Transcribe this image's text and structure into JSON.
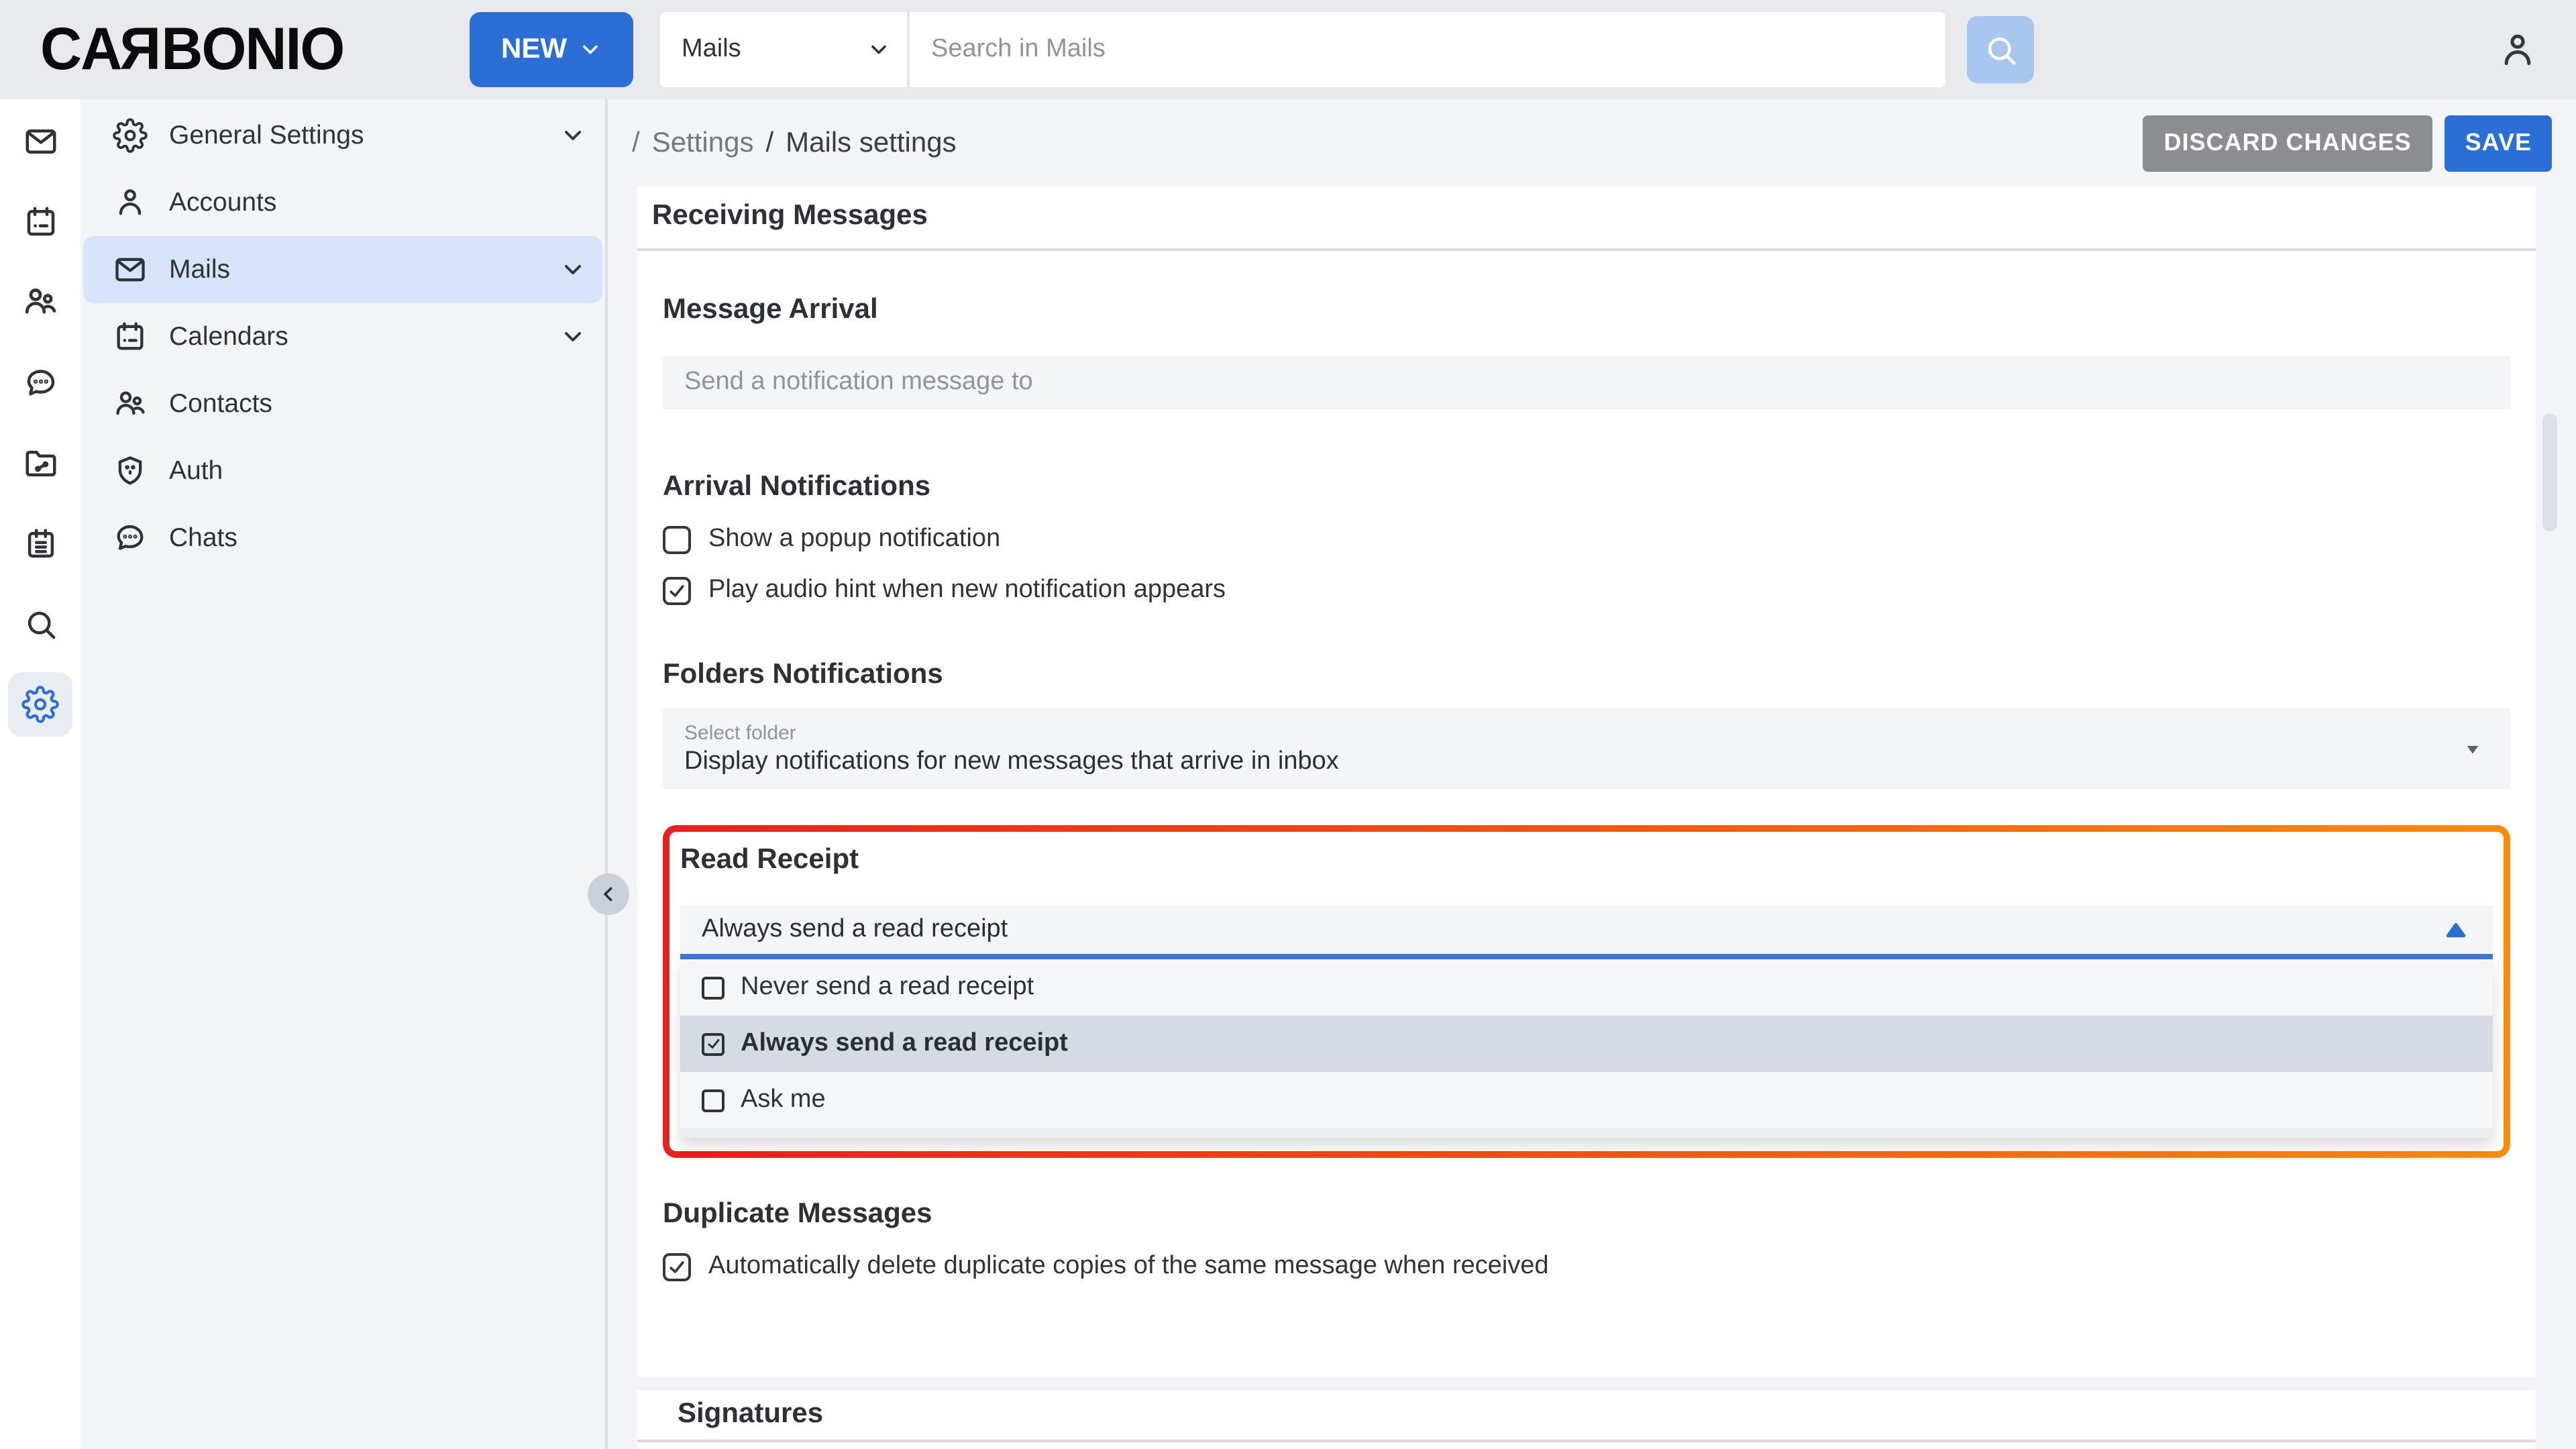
{
  "topbar": {
    "logo_part1": "CA",
    "logo_r": "R",
    "logo_part2": "BONIO",
    "new_button": "NEW",
    "search_scope": "Mails",
    "search_placeholder": "Search in Mails",
    "icons": [
      "chevron-down-icon",
      "search-icon",
      "person-icon"
    ]
  },
  "rail": {
    "items": [
      {
        "icon": "mail-icon",
        "active": false
      },
      {
        "icon": "calendar-icon",
        "active": false
      },
      {
        "icon": "contacts-icon",
        "active": false
      },
      {
        "icon": "chat-icon",
        "active": false
      },
      {
        "icon": "files-icon",
        "active": false
      },
      {
        "icon": "tasks-icon",
        "active": false
      },
      {
        "icon": "search-icon",
        "active": false
      },
      {
        "icon": "settings-gear-icon",
        "active": true
      }
    ]
  },
  "sidebar": {
    "items": [
      {
        "label": "General Settings",
        "icon": "gear-icon",
        "expandable": true,
        "selected": false
      },
      {
        "label": "Accounts",
        "icon": "person-icon",
        "expandable": false,
        "selected": false
      },
      {
        "label": "Mails",
        "icon": "mail-icon",
        "expandable": true,
        "selected": true
      },
      {
        "label": "Calendars",
        "icon": "calendar-icon",
        "expandable": true,
        "selected": false
      },
      {
        "label": "Contacts",
        "icon": "people-icon",
        "expandable": false,
        "selected": false
      },
      {
        "label": "Auth",
        "icon": "shield-icon",
        "expandable": false,
        "selected": false
      },
      {
        "label": "Chats",
        "icon": "chat-icon",
        "expandable": false,
        "selected": false
      }
    ],
    "collapse_icon": "chevron-left-icon"
  },
  "breadcrumb": {
    "sep1": "/",
    "settings": "Settings",
    "sep2": "/",
    "current": "Mails settings"
  },
  "actions": {
    "discard": "DISCARD CHANGES",
    "save": "SAVE"
  },
  "content": {
    "section_title": "Receiving Messages",
    "message_arrival": {
      "heading": "Message Arrival",
      "placeholder": "Send a notification message to"
    },
    "arrival_notifications": {
      "heading": "Arrival Notifications",
      "options": [
        {
          "label": "Show a popup notification",
          "checked": false
        },
        {
          "label": "Play audio hint when new notification appears",
          "checked": true
        }
      ]
    },
    "folders_notifications": {
      "heading": "Folders Notifications",
      "select_label": "Select folder",
      "select_value": "Display notifications for new messages that arrive in inbox"
    },
    "read_receipt": {
      "heading": "Read Receipt",
      "select_value": "Always send a read receipt",
      "dropdown_open": true,
      "options": [
        {
          "label": "Never send a read receipt",
          "checked": false,
          "selected": false
        },
        {
          "label": "Always send a read receipt",
          "checked": true,
          "selected": true
        },
        {
          "label": "Ask me",
          "checked": false,
          "selected": false
        }
      ]
    },
    "duplicate_messages": {
      "heading": "Duplicate Messages",
      "option": {
        "label": "Automatically delete duplicate copies of the same message when received",
        "checked": true
      }
    },
    "signatures": {
      "heading": "Signatures"
    }
  },
  "colors": {
    "accent_blue": "#2b6fd6",
    "search_button_blue": "#a9c6ee",
    "sidebar_selected": "#d6e3f8",
    "highlight_border_start": "#e7211d",
    "highlight_border_end": "#f98c0c",
    "dropdown_selected_row": "#d6dae2",
    "discard_gray": "#8c8d90"
  }
}
